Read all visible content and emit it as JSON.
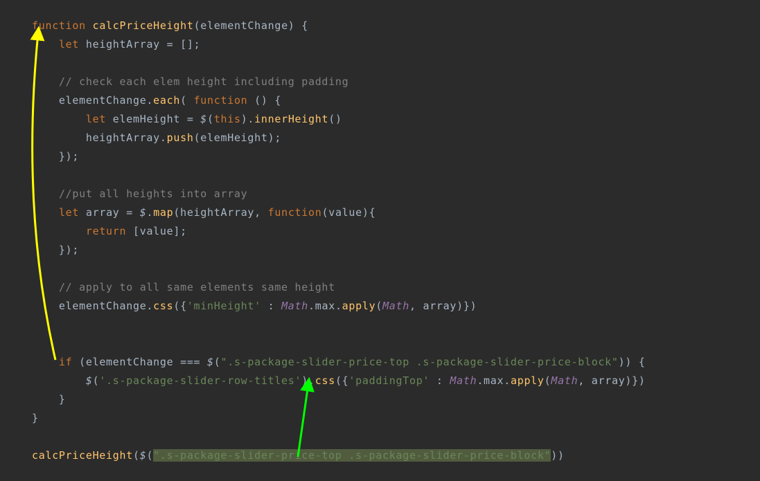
{
  "code": {
    "l1": "function calcPriceHeight(elementChange) {",
    "l1_a": "function",
    "l1_b": " ",
    "l1_c": "calcPriceHeight",
    "l1_d": "(",
    "l1_e": "elementChange",
    "l1_f": ") {",
    "l2_a": "    ",
    "l2_b": "let",
    "l2_c": " heightArray = [];",
    "l3": "",
    "l4_a": "    ",
    "l4_b": "// check each elem height including padding",
    "l5_a": "    elementChange.",
    "l5_b": "each",
    "l5_c": "( ",
    "l5_d": "function",
    "l5_e": " () {",
    "l6_a": "        ",
    "l6_b": "let",
    "l6_c": " elemHeight = ",
    "l6_d": "$",
    "l6_e": "(",
    "l6_f": "this",
    "l6_g": ").",
    "l6_h": "innerHeight",
    "l6_i": "()",
    "l7_a": "        heightArray.",
    "l7_b": "push",
    "l7_c": "(elemHeight);",
    "l8": "    });",
    "l9": "",
    "l10_a": "    ",
    "l10_b": "//put all heights into array",
    "l11_a": "    ",
    "l11_b": "let",
    "l11_c": " array = ",
    "l11_d": "$",
    "l11_e": ".",
    "l11_f": "map",
    "l11_g": "(heightArray, ",
    "l11_h": "function",
    "l11_i": "(value){",
    "l12_a": "        ",
    "l12_b": "return",
    "l12_c": " [value];",
    "l13": "    });",
    "l14": "",
    "l15_a": "    ",
    "l15_b": "// apply to all same elements same height",
    "l16_a": "    elementChange.",
    "l16_b": "css",
    "l16_c": "({",
    "l16_d": "'minHeight'",
    "l16_e": " : ",
    "l16_f": "Math",
    "l16_g": ".max.",
    "l16_h": "apply",
    "l16_i": "(",
    "l16_j": "Math",
    "l16_k": ", array)})",
    "l17": "",
    "l18": "",
    "l19_a": "    ",
    "l19_b": "if",
    "l19_c": " (elementChange === ",
    "l19_d": "$",
    "l19_e": "(",
    "l19_f": "\".s-package-slider-price-top .s-package-slider-price-block\"",
    "l19_g": ")) {",
    "l20_a": "        ",
    "l20_b": "$",
    "l20_c": "(",
    "l20_d": "'.s-package-slider-row-titles'",
    "l20_e": ").",
    "l20_f": "css",
    "l20_g": "({",
    "l20_h": "'paddingTop'",
    "l20_i": " : ",
    "l20_j": "Math",
    "l20_k": ".max.",
    "l20_l": "apply",
    "l20_m": "(",
    "l20_n": "Math",
    "l20_o": ", array)})",
    "l21": "    }",
    "l22": "}",
    "l23": "",
    "l24_a": "calcPriceHeight",
    "l24_b": "(",
    "l24_c": "$",
    "l24_d": "(",
    "l24_e": "\".s-package-slider-price-top .s-package-slider-price-block\"",
    "l24_f": "))"
  },
  "colors": {
    "background": "#2b2b2b",
    "keyword": "#cc7832",
    "function": "#ffc66d",
    "string": "#6a8759",
    "comment": "#808080",
    "class": "#9876aa",
    "default": "#a9b7c6",
    "highlight": "#515c3f",
    "arrow_yellow": "#ffff00",
    "arrow_green": "#00ff00"
  }
}
